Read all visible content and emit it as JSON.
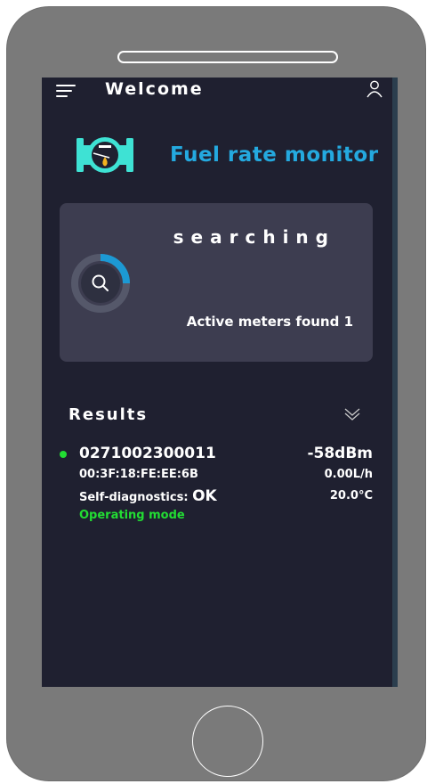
{
  "header": {
    "title": "Welcome"
  },
  "app": {
    "name": "Fuel rate monitor",
    "accent_color": "#24a9df"
  },
  "scan": {
    "status": "searching",
    "found_label": "Active meters found 1"
  },
  "results": {
    "heading": "Results",
    "items": [
      {
        "id": "0271002300011",
        "rssi": "-58dBm",
        "mac": "00:3F:18:FE:EE:6B",
        "rate": "0.00L/h",
        "diag_label": "Self-diagnostics:",
        "diag_value": "OK",
        "temperature": "20.0°C",
        "mode": "Operating mode",
        "status_color": "#22dd33"
      }
    ]
  },
  "icons": {
    "menu": "hamburger-icon",
    "user": "user-icon",
    "logo": "fuel-meter-icon",
    "search": "search-icon",
    "expand": "chevrons-down-icon"
  }
}
